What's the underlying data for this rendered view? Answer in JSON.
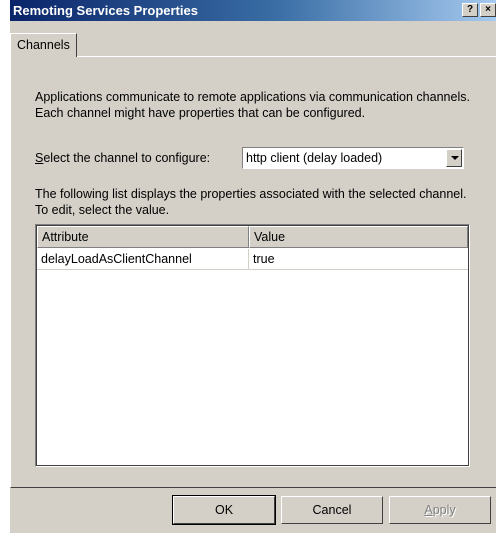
{
  "window": {
    "title": "Remoting Services Properties",
    "help_button": "?",
    "close_button": "×"
  },
  "tabs": [
    {
      "label": "Channels",
      "selected": true
    }
  ],
  "description": "Applications communicate to remote applications via communication channels.  Each channel might have properties that can be configured.",
  "channel_select": {
    "label_accel": "S",
    "label_rest": "elect the channel to configure:",
    "value": "http client (delay loaded)"
  },
  "list_description": "The following list displays the properties associated with the selected channel.  To edit, select the value.",
  "properties_table": {
    "columns": [
      "Attribute",
      "Value"
    ],
    "rows": [
      {
        "attribute": "delayLoadAsClientChannel",
        "value": "true"
      }
    ]
  },
  "buttons": {
    "ok": "OK",
    "cancel": "Cancel",
    "apply_accel": "A",
    "apply_rest": "pply"
  },
  "colors": {
    "title_gradient_start": "#0a246a",
    "title_gradient_end": "#a6caf0",
    "dialog_face": "#d4d0c8"
  }
}
